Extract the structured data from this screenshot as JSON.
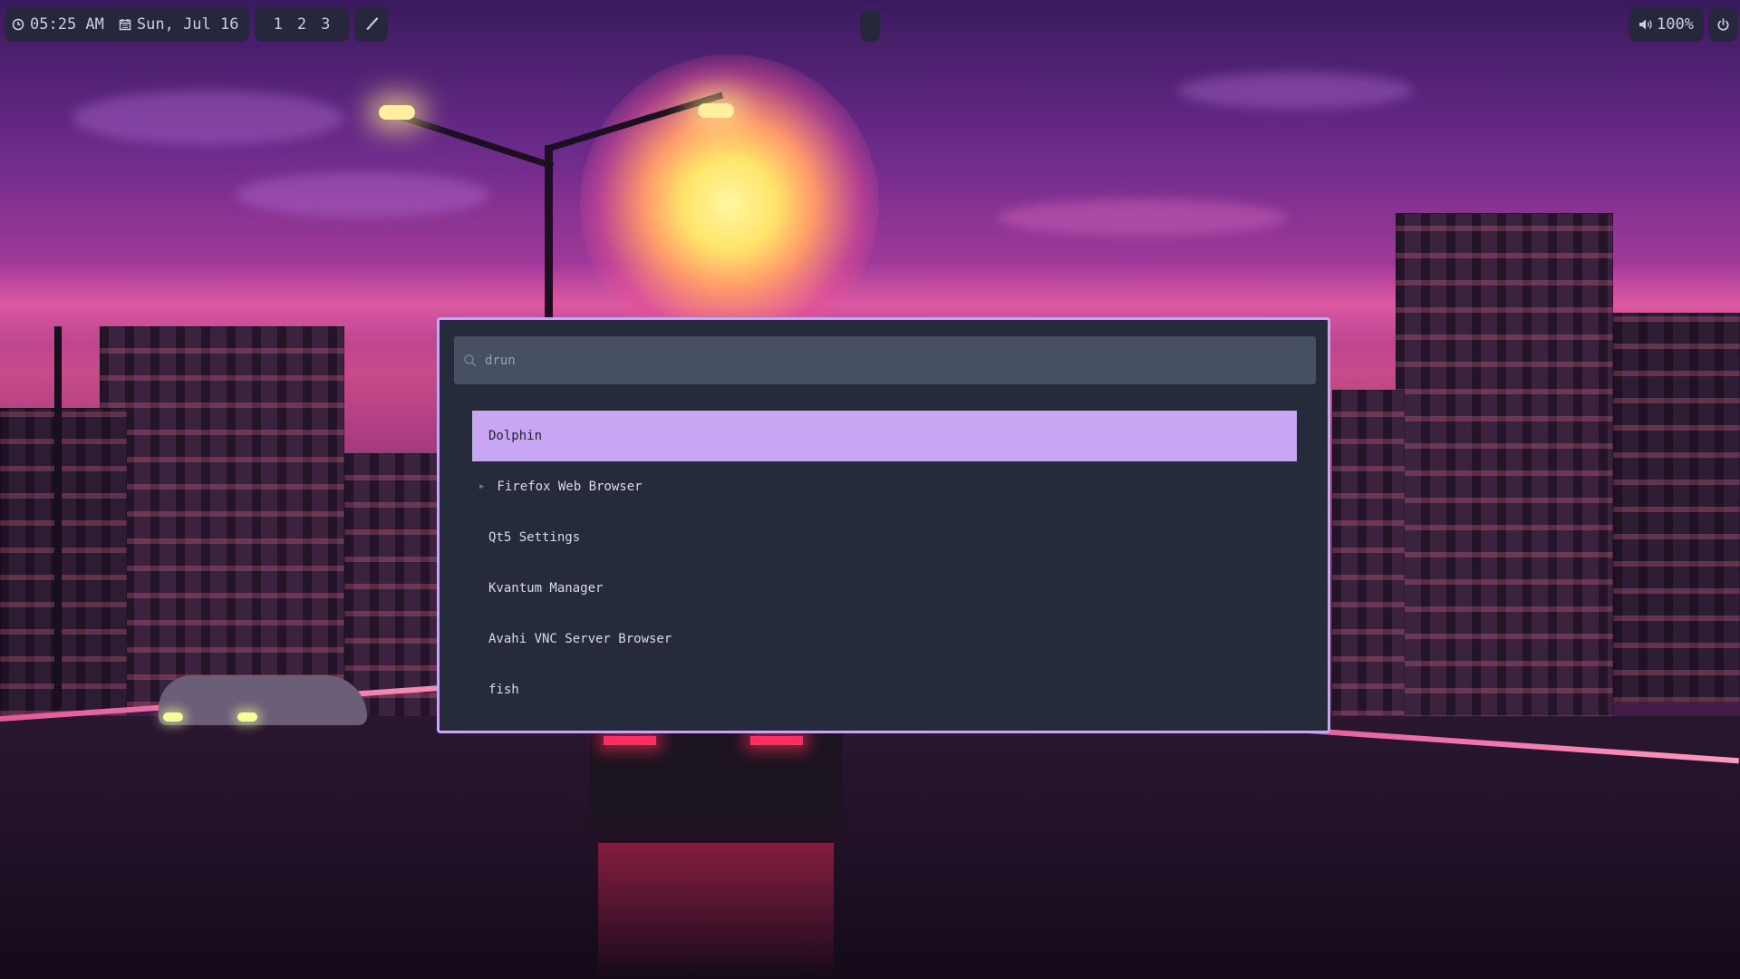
{
  "topbar": {
    "clock": {
      "icon": "clock-icon",
      "time": "05:25 AM"
    },
    "date": {
      "icon": "calendar-icon",
      "label": "Sun, Jul 16"
    },
    "workspaces": [
      "1",
      "2",
      "3"
    ],
    "edit_icon": "brush-icon",
    "volume": {
      "icon": "speaker-icon",
      "value": "100%"
    },
    "power_icon": "power-icon"
  },
  "launcher": {
    "search": {
      "icon": "search-icon",
      "placeholder": "drun",
      "value": ""
    },
    "results": [
      {
        "label": "Dolphin",
        "selected": true
      },
      {
        "label": "Firefox Web Browser",
        "selected": false,
        "has_caret": true
      },
      {
        "label": "Qt5 Settings",
        "selected": false
      },
      {
        "label": "Kvantum Manager",
        "selected": false
      },
      {
        "label": "Avahi VNC Server Browser",
        "selected": false
      },
      {
        "label": "fish",
        "selected": false
      }
    ]
  },
  "colors": {
    "accent": "#c9a6f2",
    "panel": "#262b3b",
    "search_bg": "#474f62",
    "bar_bg": "#242838"
  }
}
